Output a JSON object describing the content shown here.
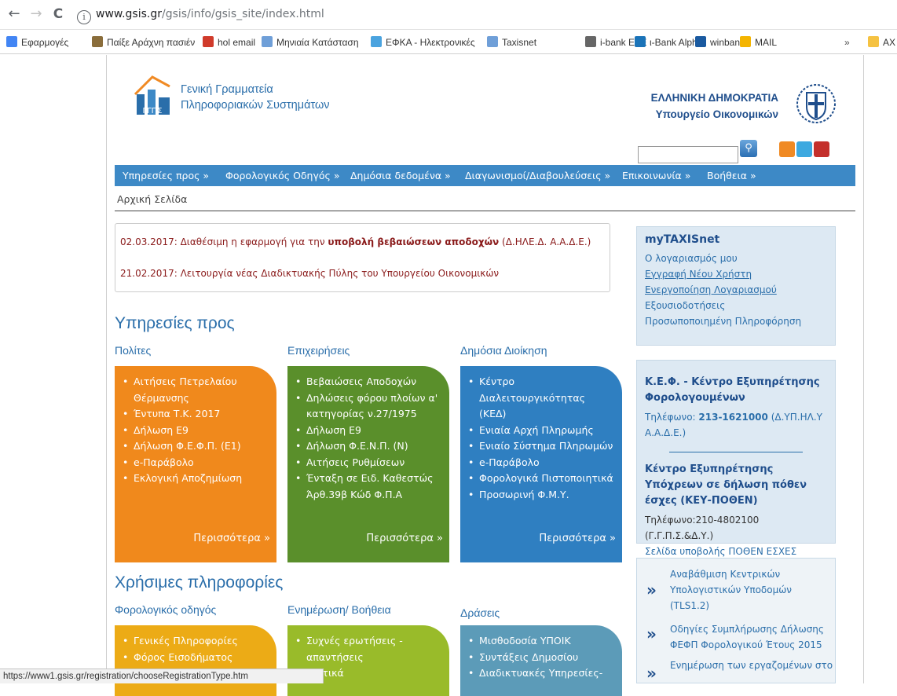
{
  "browser": {
    "back": "←",
    "forward": "→",
    "reload": "C",
    "url_host": "www.gsis.gr",
    "url_path": "/gsis/info/gsis_site/index.html",
    "bookmarks": [
      "Εφαρμογές",
      "Παίξε Αράχνη πασιέν",
      "hol email",
      "Μηνιαία Κατάσταση",
      "ΕΦΚΑ - Ηλεκτρονικές",
      "Taxisnet",
      "i-bank ETE",
      "ι-Bank Alpha",
      "winbank",
      "MAIL"
    ],
    "more_bookmarks": "»",
    "overflow_bookmark": "ΑΧ"
  },
  "header": {
    "logo_line1": "Γενική Γραμματεία",
    "logo_line2": "Πληροφοριακών Συστημάτων",
    "gov_line1": "ΕΛΛΗΝΙΚΗ ΔΗΜΟΚΡΑΤΙΑ",
    "gov_line2": "Υπουργείο Οικονομικών"
  },
  "nav": [
    "Υπηρεσίες προς »",
    "Φορολογικός Οδηγός »",
    "Δημόσια δεδομένα »",
    "Διαγωνισμοί/Διαβουλεύσεις »",
    "Επικοινωνία »",
    "Βοήθεια »"
  ],
  "breadcrumb": "Αρχική Σελίδα",
  "news": [
    {
      "date": "02.03.2017:",
      "pre": " Διαθέσιμη η εφαρμογή για την ",
      "bold": "υποβολή βεβαιώσεων αποδοχών",
      "post": " (Δ.ΗΛΕ.Δ. Α.Α.Δ.Ε.)"
    },
    {
      "date": "21.02.2017:",
      "pre": " Λειτουργία νέας Διαδικτυακής Πύλης του Υπουργείου Οικονομικών",
      "bold": "",
      "post": ""
    }
  ],
  "services": {
    "title": "Υπηρεσίες προς",
    "columns": [
      {
        "heading": "Πολίτες",
        "items": [
          "Αιτήσεις Πετρελαίου Θέρμανσης",
          "Έντυπα Τ.Κ. 2017",
          "Δήλωση Ε9",
          "Δήλωση Φ.Ε.Φ.Π. (Ε1)",
          "e-Παράβολο",
          "Εκλογική Αποζημίωση"
        ],
        "more": "Περισσότερα »",
        "color": "#f0891c"
      },
      {
        "heading": "Επιχειρήσεις",
        "items": [
          "Βεβαιώσεις Αποδοχών",
          "Δηλώσεις φόρου πλοίων α' κατηγορίας ν.27/1975",
          "Δήλωση Ε9",
          "Δήλωση Φ.Ε.Ν.Π. (Ν)",
          "Αιτήσεις Ρυθμίσεων",
          "Ένταξη σε Ειδ. Καθεστώς Άρθ.39β Κώδ Φ.Π.Α"
        ],
        "more": "Περισσότερα »",
        "color": "#5a8f2b"
      },
      {
        "heading": "Δημόσια Διοίκηση",
        "items": [
          "Κέντρο Διαλειτουργικότητας (ΚΕΔ)",
          "Ενιαία Αρχή Πληρωμής",
          "Ενιαίο Σύστημα Πληρωμών",
          "e-Παράβολο",
          "Φορολογικά Πιστοποιητικά",
          "Προσωρινή Φ.Μ.Υ."
        ],
        "more": "Περισσότερα »",
        "color": "#2f7fc1"
      }
    ]
  },
  "useful": {
    "title": "Χρήσιμες πληροφορίες",
    "columns": [
      {
        "heading": "Φορολογικός οδηγός",
        "items": [
          "Γενικές Πληροφορίες",
          "Φόρος Εισοδήματος"
        ],
        "color": "#ecab16"
      },
      {
        "heading": "Ενημέρωση/ Βοήθεια",
        "items": [
          "Συχνές ερωτήσεις - απαντήσεις",
          "…στικά"
        ],
        "color": "#99bb2a"
      },
      {
        "heading": "Δράσεις",
        "items": [
          "Μισθοδοσία ΥΠΟΙΚ",
          "Συντάξεις Δημοσίου",
          "Διαδικτυακές Υπηρεσίες-"
        ],
        "color": "#5c9bb8"
      }
    ]
  },
  "mytaxisnet": {
    "title": "myTAXISnet",
    "links": [
      "Ο λογαριασμός μου",
      "Εγγραφή Νέου Χρήστη",
      "Ενεργοποίηση Λογαριασμού",
      "Εξουσιοδοτήσεις",
      "Προσωποποιημένη Πληροφόρηση"
    ]
  },
  "kef": {
    "title": "Κ.Ε.Φ. - Κέντρο Εξυπηρέτησης Φορολογουμένων",
    "phone_label": "Τηλέφωνο: ",
    "phone": "213-1621000",
    "phone_note": "(Δ.ΥΠ.ΗΛ.Υ Α.Α.Δ.Ε.)",
    "title2": "Κέντρο Εξυπηρέτησης Υπόχρεων σε δήλωση πόθεν έσχες (ΚΕΥ-ΠΟΘΕΝ)",
    "phone2": "Τηλέφωνο:210-4802100 (Γ.Γ.Π.Σ.&Δ.Υ.)",
    "link2": "Σελίδα υποβολής ΠΟΘΕΝ ΕΣΧΕΣ"
  },
  "announcements": [
    "Αναβάθμιση Κεντρικών Υπολογιστικών Υποδομών (TLS1.2)",
    "Οδηγίες Συμπλήρωσης Δήλωσης ΦΕΦΠ Φορολογικού Έτους 2015",
    "Ενημέρωση των εργαζομένων στο"
  ],
  "status_url": "https://www1.gsis.gr/registration/chooseRegistrationType.htm",
  "colors": {
    "nav": "#3d89c6",
    "brand": "#2a6eaa",
    "news_text": "#8a1a1a"
  }
}
